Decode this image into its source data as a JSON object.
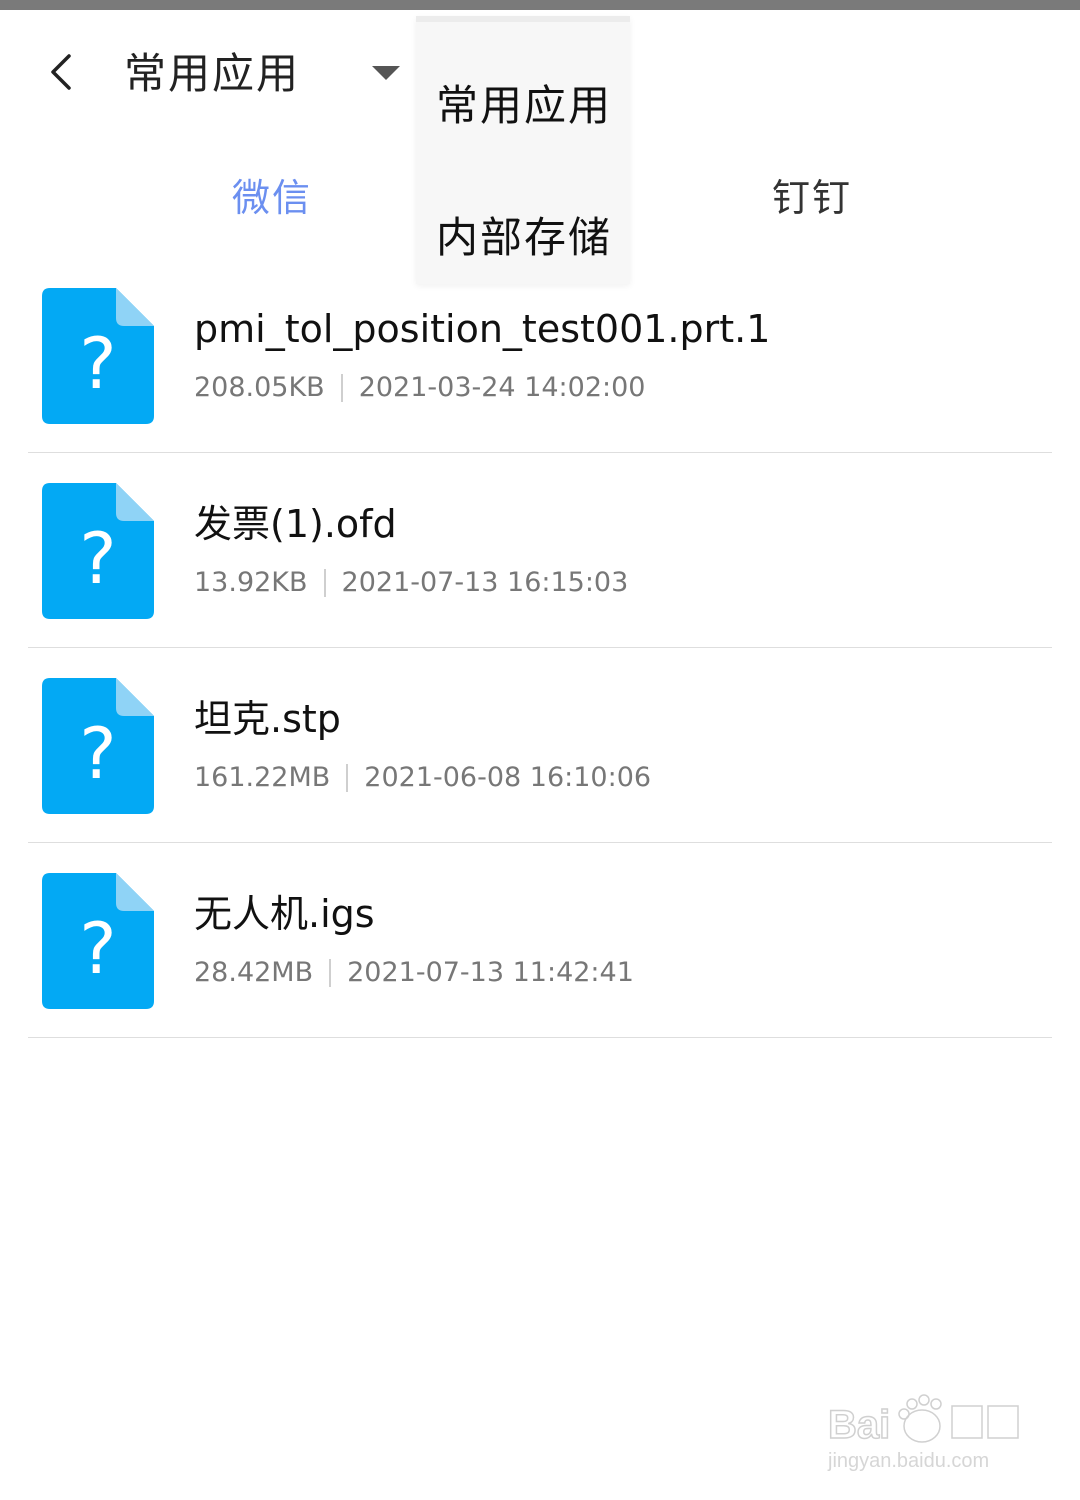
{
  "header": {
    "back_icon": "chevron-left-icon",
    "title": "常用应用",
    "dropdown_icon": "caret-down-icon"
  },
  "tabs": [
    {
      "label": "微信",
      "active": true
    },
    {
      "label": "钉钉",
      "active": false
    }
  ],
  "dropdown": {
    "items": [
      {
        "label": "常用应用"
      },
      {
        "label": "内部存储"
      }
    ]
  },
  "files": [
    {
      "name": "pmi_tol_position_test001.prt.1",
      "size": "208.05KB",
      "date": "2021-03-24 14:02:00",
      "icon": "unknown-file-icon"
    },
    {
      "name": "发票(1).ofd",
      "size": "13.92KB",
      "date": "2021-07-13 16:15:03",
      "icon": "unknown-file-icon"
    },
    {
      "name": "坦克.stp",
      "size": "161.22MB",
      "date": "2021-06-08 16:10:06",
      "icon": "unknown-file-icon"
    },
    {
      "name": "无人机.igs",
      "size": "28.42MB",
      "date": "2021-07-13 11:42:41",
      "icon": "unknown-file-icon"
    }
  ],
  "colors": {
    "accent": "#6b8ff0",
    "file_icon": "#03a9f4",
    "file_icon_fold": "#8fd3f6"
  },
  "watermark": {
    "url": "jingyan.baidu.com"
  }
}
